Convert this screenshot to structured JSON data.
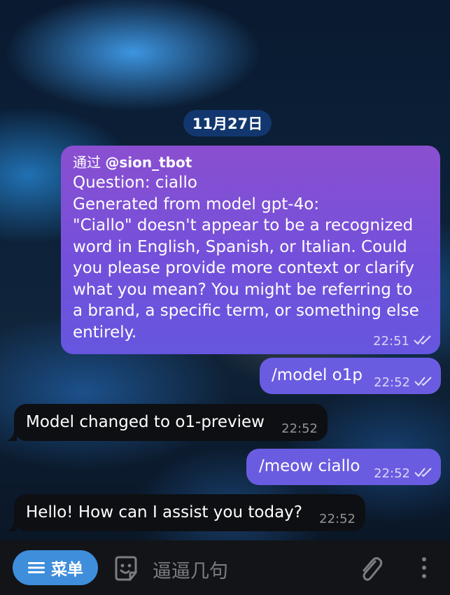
{
  "date_label": "11月27日",
  "messages": [
    {
      "via_prefix": "通过 ",
      "via_handle": "@sion_tbot",
      "lines": [
        "Question: ciallo",
        "Generated from model gpt-4o:",
        "\"Ciallo\" doesn't appear to be a recognized",
        "word in English, Spanish, or Italian. Could",
        "you please provide more context or clarify",
        "what you mean? You might be referring to",
        "a brand, a specific term, or something else",
        "entirely."
      ],
      "time": "22:51"
    },
    {
      "text": "/model o1p",
      "time": "22:52"
    },
    {
      "text": "Model changed to o1-preview",
      "time": "22:52"
    },
    {
      "text": "/meow ciallo",
      "time": "22:52"
    },
    {
      "text": "Hello! How can I assist you today?",
      "time": "22:52"
    }
  ],
  "composer": {
    "menu_label": "菜单",
    "placeholder": "逼逼几句"
  },
  "icons": [
    "double-check-icon",
    "menu-lines-icon",
    "emoji-icon",
    "paperclip-icon",
    "more-vertical-icon"
  ],
  "colors": {
    "outgoing_bubble_gradient_top": "#8a4fd0",
    "outgoing_bubble": "#6a5ce0",
    "incoming_bubble": "#0d0f12",
    "menu_button": "#3f8edb",
    "date_pill": "#143c78"
  }
}
